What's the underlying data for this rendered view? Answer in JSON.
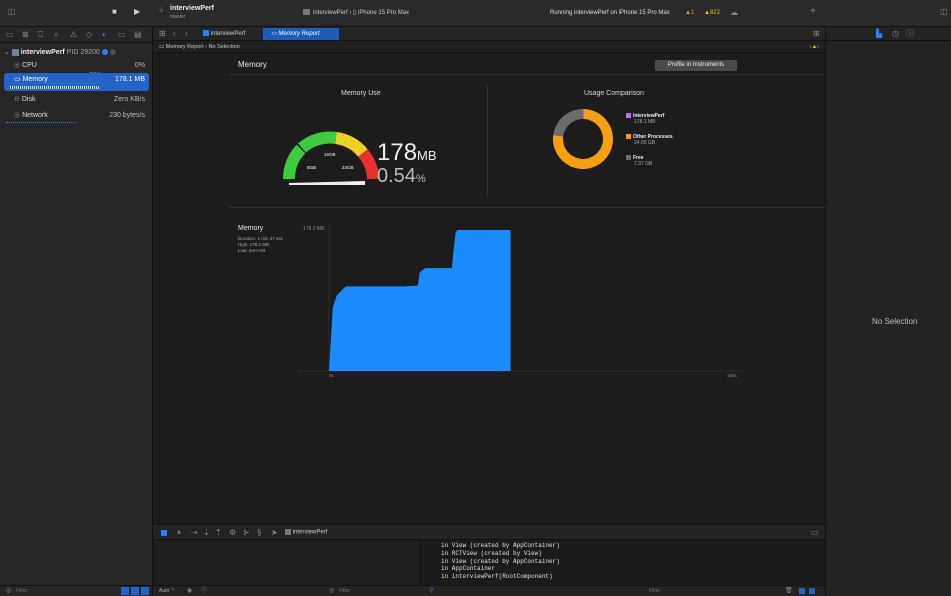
{
  "toolbar": {
    "project_name": "interviewPerf",
    "branch": "master",
    "scheme": "interviewPerf",
    "separator": "›",
    "device": "iPhone 15 Pro Max",
    "status": "Running interviewPerf on iPhone 15 Pro Max",
    "warnings_1": "1",
    "warnings_2": "822"
  },
  "tabs": [
    {
      "label": "interviewPerf"
    },
    {
      "label": "Memory Report"
    }
  ],
  "breadcrumb": {
    "first": "Memory Report",
    "second": "No Selection"
  },
  "navigator": {
    "process_name": "interviewPerf",
    "pid": "PID 29200",
    "gauges": [
      {
        "label": "CPU",
        "value": "0%"
      },
      {
        "label": "Memory",
        "value": "178.1 MB"
      },
      {
        "label": "Disk",
        "value": "Zero KB/s"
      },
      {
        "label": "Network",
        "value": "230 bytes/s"
      }
    ],
    "filter_placeholder": "Filter"
  },
  "report": {
    "title": "Memory",
    "profile_button": "Profile in Instruments",
    "memory_use_title": "Memory Use",
    "usage_comparison_title": "Usage Comparison",
    "gauge_ticks": [
      "8GB",
      "16GB",
      "24GB",
      "32GB"
    ],
    "big_value": "178",
    "big_unit": "MB",
    "percent_value": "0.54",
    "percent_unit": "%",
    "legend": [
      {
        "name": "interviewPerf",
        "value": "178.1 MB",
        "color": "#b86cf0"
      },
      {
        "name": "Other Processes",
        "value": "24.65 GB",
        "color": "#f5a00c"
      },
      {
        "name": "Free",
        "value": "7.37 GB",
        "color": "#6b6b6b"
      }
    ],
    "chart_title": "Memory",
    "duration": "Duration: 1 min 37 sec",
    "high": "High: 178.2 MB",
    "low": "Low: Zero KB",
    "y_max_label": "178.2 MB",
    "x_start_label": "0s",
    "x_end_label": "180s"
  },
  "inspector": {
    "empty_text": "No Selection"
  },
  "debug": {
    "scheme_label": "interviewPerf",
    "console_lines": [
      "in View (created by AppContainer)",
      "in RCTView (created by View)",
      "in View (created by AppContainer)",
      "in AppContainer",
      "in interviewPerf(RootComponent)"
    ],
    "auto_label": "Auto",
    "filter_placeholder": "Filter"
  },
  "chart_data": [
    {
      "type": "pie",
      "title": "Usage Comparison",
      "categories": [
        "interviewPerf",
        "Other Processes",
        "Free"
      ],
      "values": [
        0.1781,
        24.65,
        7.37
      ],
      "unit": "GB"
    },
    {
      "type": "area",
      "title": "Memory",
      "xlabel": "",
      "ylabel": "",
      "xlim": [
        0,
        180
      ],
      "ylim": [
        0,
        178.2
      ],
      "x": [
        0,
        2,
        4,
        8,
        9,
        40,
        47,
        48,
        51,
        65,
        66,
        67,
        68,
        71,
        96
      ],
      "y": [
        0,
        80,
        95,
        105,
        107,
        107,
        108,
        125,
        130,
        130,
        155,
        175,
        178.2,
        178.2,
        178.2
      ],
      "series": [
        {
          "name": "",
          "values": []
        }
      ]
    }
  ]
}
